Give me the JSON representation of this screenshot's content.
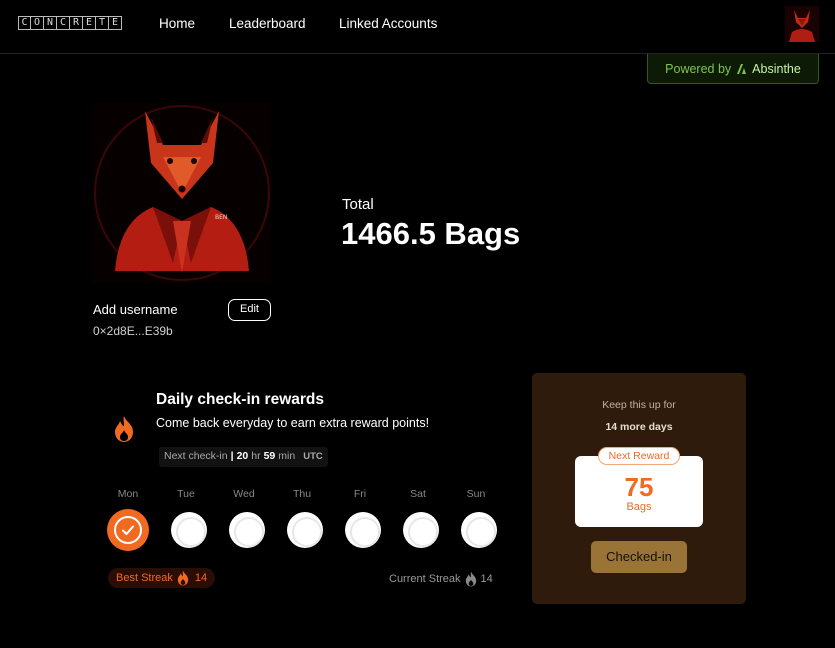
{
  "nav": {
    "logo_letters": [
      "C",
      "O",
      "N",
      "C",
      "R",
      "E",
      "T",
      "E"
    ],
    "home": "Home",
    "leaderboard": "Leaderboard",
    "linked_accounts": "Linked Accounts"
  },
  "powered": {
    "prefix": "Powered by",
    "brand": "Absinthe"
  },
  "profile": {
    "username": "Add username",
    "edit_label": "Edit",
    "address": "0×2d8E...E39b"
  },
  "total": {
    "label": "Total",
    "value": "1466.5 Bags"
  },
  "daily": {
    "title": "Daily check-in rewards",
    "subtitle": "Come back everyday to earn extra reward points!",
    "next_label": "Next check-in",
    "next_sep": "|",
    "next_hours": "20",
    "next_hr_unit": "hr",
    "next_minutes": "59",
    "next_min_unit": "min",
    "next_tz": "UTC",
    "days": [
      "Mon",
      "Tue",
      "Wed",
      "Thu",
      "Fri",
      "Sat",
      "Sun"
    ],
    "checked_days": [
      true,
      false,
      false,
      false,
      false,
      false,
      false
    ],
    "best_streak_label": "Best Streak",
    "best_streak_value": "14",
    "current_streak_label": "Current Streak",
    "current_streak_value": "14"
  },
  "reward": {
    "keep_up": "Keep this up for",
    "more_days": "14 more days",
    "next_reward_label": "Next Reward",
    "amount": "75",
    "unit": "Bags",
    "button_label": "Checked-in"
  },
  "colors": {
    "accent": "#f06a22",
    "card_bg": "#2f1b0b",
    "button_bg": "#9a7437",
    "absinthe_green": "#7fc44a"
  },
  "icons": [
    "fox-avatar-icon",
    "flame-icon",
    "check-icon",
    "absinthe-logo-icon"
  ]
}
